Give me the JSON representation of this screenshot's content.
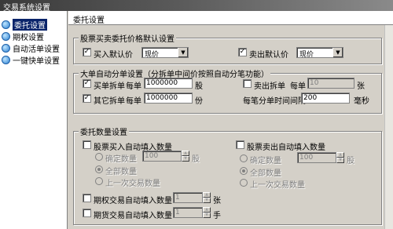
{
  "window": {
    "title": "交易系统设置"
  },
  "sidebar": {
    "items": [
      {
        "label": "委托设置"
      },
      {
        "label": "期权设置"
      },
      {
        "label": "自动活单设置"
      },
      {
        "label": "一键快单设置"
      }
    ]
  },
  "header": {
    "title": "委托设置"
  },
  "price_group": {
    "title": "股票买卖委托价格默认设置",
    "buy_label": "买入默认价",
    "buy_value": "现价",
    "sell_label": "卖出默认价",
    "sell_value": "现价"
  },
  "split_group": {
    "title": "大单自动分单设置（分拆单中间价按照自动分笔功能）",
    "buy_split_label": "买单拆单",
    "buy_each_label": "每单",
    "buy_each_value": "1000000",
    "buy_unit": "股",
    "sell_split_label": "卖出拆单",
    "sell_each_label": "每单",
    "sell_each_value": "10",
    "sell_unit": "张",
    "other_split_label": "其它拆单",
    "other_each_label": "每单",
    "other_each_value": "1000000",
    "other_unit": "份",
    "interval_label": "每笔分单时间间隔",
    "interval_value": "200",
    "interval_unit": "毫秒"
  },
  "qty_group": {
    "title": "委托数量设置",
    "stock_buy_auto_label": "股票买入自动填入数量",
    "fixed_qty_label": "确定数量",
    "fixed_qty_value": "100",
    "fixed_qty_unit": "股",
    "all_qty_label": "全部数量",
    "last_qty_label": "上一次交易数量",
    "stock_sell_auto_label": "股票卖出自动填入数量",
    "sell_fixed_qty_label": "确定数量",
    "sell_fixed_qty_value": "100",
    "sell_fixed_qty_unit": "股",
    "sell_all_qty_label": "全部数量",
    "sell_last_qty_label": "上一次交易数量",
    "option_auto_label": "期权交易自动填入数量",
    "option_value": "1",
    "option_unit": "张",
    "futures_auto_label": "期货交易自动填入数量",
    "futures_value": "1",
    "futures_unit": "手"
  }
}
